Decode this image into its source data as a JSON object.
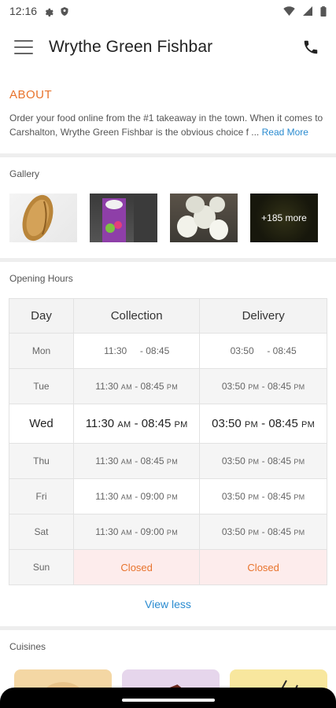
{
  "status_bar": {
    "time": "12:16",
    "icons": [
      "gear-icon",
      "shield-icon",
      "wifi-icon",
      "signal-icon",
      "battery-icon"
    ]
  },
  "app_bar": {
    "title": "Wrythe Green Fishbar",
    "menu_icon": "hamburger-menu-icon",
    "call_icon": "phone-icon"
  },
  "about": {
    "title": "ABOUT",
    "text": "Order your food online from the #1 takeaway in the town. When it comes to Carshalton, Wrythe Green Fishbar is the obvious choice f ...",
    "read_more": "Read More"
  },
  "gallery": {
    "label": "Gallery",
    "more_label": "+185 more"
  },
  "opening_hours": {
    "label": "Opening Hours",
    "headers": [
      "Day",
      "Collection",
      "Delivery"
    ],
    "rows": [
      {
        "day": "Mon",
        "col_start": "11:30",
        "col_start_ampm": "",
        "col_end": "08:45",
        "col_end_ampm": "",
        "del_start": "03:50",
        "del_start_ampm": "",
        "del_end": "08:45",
        "del_end_ampm": ""
      },
      {
        "day": "Tue",
        "col_start": "11:30",
        "col_start_ampm": "AM",
        "col_end": "08:45",
        "col_end_ampm": "PM",
        "del_start": "03:50",
        "del_start_ampm": "PM",
        "del_end": "08:45",
        "del_end_ampm": "PM"
      },
      {
        "day": "Wed",
        "col_start": "11:30",
        "col_start_ampm": "AM",
        "col_end": "08:45",
        "col_end_ampm": "PM",
        "del_start": "03:50",
        "del_start_ampm": "PM",
        "del_end": "08:45",
        "del_end_ampm": "PM"
      },
      {
        "day": "Thu",
        "col_start": "11:30",
        "col_start_ampm": "AM",
        "col_end": "08:45",
        "col_end_ampm": "PM",
        "del_start": "03:50",
        "del_start_ampm": "PM",
        "del_end": "08:45",
        "del_end_ampm": "PM"
      },
      {
        "day": "Fri",
        "col_start": "11:30",
        "col_start_ampm": "AM",
        "col_end": "09:00",
        "col_end_ampm": "PM",
        "del_start": "03:50",
        "del_start_ampm": "PM",
        "del_end": "08:45",
        "del_end_ampm": "PM"
      },
      {
        "day": "Sat",
        "col_start": "11:30",
        "col_start_ampm": "AM",
        "col_end": "09:00",
        "col_end_ampm": "PM",
        "del_start": "03:50",
        "del_start_ampm": "PM",
        "del_end": "08:45",
        "del_end_ampm": "PM"
      }
    ],
    "sunday": {
      "day": "Sun",
      "collection": "Closed",
      "delivery": "Closed"
    },
    "view_less": "View less"
  },
  "cuisines": {
    "label": "Cuisines"
  },
  "colors": {
    "accent_orange": "#e8732c",
    "link_blue": "#2a8bd0",
    "closed_bg": "#fdecec"
  }
}
